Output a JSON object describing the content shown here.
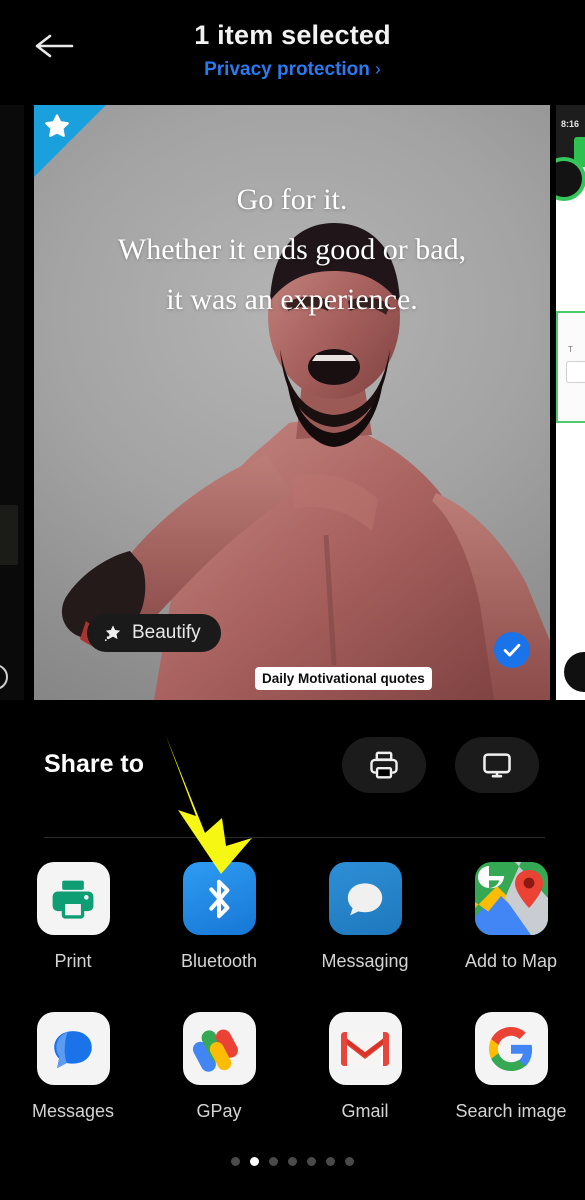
{
  "header": {
    "back_icon": "back-arrow-icon",
    "title": "1 item selected",
    "privacy_link": "Privacy protection",
    "privacy_chevron": "›"
  },
  "preview": {
    "favorite_icon": "star-icon",
    "quote_lines": [
      "Go for it.",
      "Whether it ends good or bad,",
      "it was an experience."
    ],
    "beautify_label": "Beautify",
    "beautify_icon": "sparkle-wand-icon",
    "file_label": "Daily Motivational quotes",
    "selected_icon": "check-icon",
    "selected": true,
    "right_thumb_time": "8:16",
    "right_thumb_field_label": "T"
  },
  "share_sheet": {
    "heading": "Share to",
    "quick_actions": [
      {
        "name": "print-button",
        "icon": "printer-icon"
      },
      {
        "name": "cast-button",
        "icon": "monitor-cast-icon"
      }
    ],
    "apps": [
      [
        {
          "label": "Print",
          "icon": "print-icon"
        },
        {
          "label": "Bluetooth",
          "icon": "bluetooth-icon"
        },
        {
          "label": "Messaging",
          "icon": "messaging-icon"
        },
        {
          "label": "Add to Map",
          "icon": "google-maps-icon",
          "truncated": true
        }
      ],
      [
        {
          "label": "Messages",
          "icon": "google-messages-icon"
        },
        {
          "label": "GPay",
          "icon": "gpay-icon"
        },
        {
          "label": "Gmail",
          "icon": "gmail-icon"
        },
        {
          "label": "Search image",
          "icon": "google-icon",
          "truncated": true
        }
      ]
    ],
    "page_dots": {
      "count": 7,
      "active_index": 1
    }
  },
  "annotation": {
    "arrow_icon": "yellow-arrow-annotation",
    "color": "#f7f714",
    "points_at": "Bluetooth"
  },
  "colors": {
    "background": "#000000",
    "accent_blue": "#2a7bf0",
    "selected_blue": "#1a73e8",
    "ribbon_blue": "#1aa0dd",
    "annotation_yellow": "#f7f714",
    "label_gray": "#d4d4d4"
  }
}
